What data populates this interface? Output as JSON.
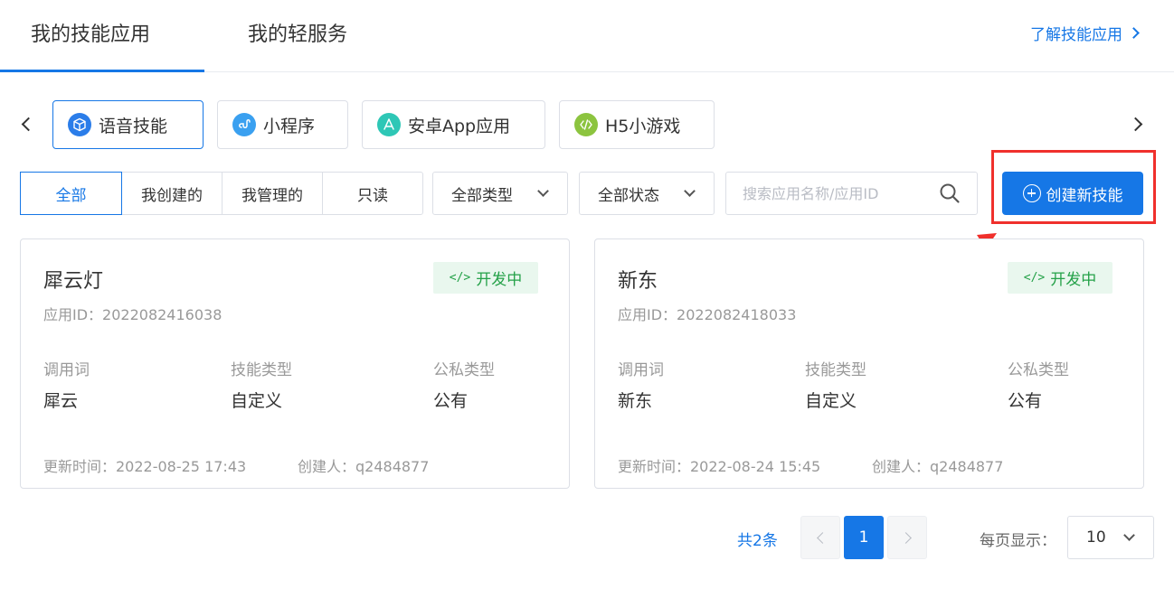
{
  "top_tabs": [
    {
      "label": "我的技能应用",
      "active": true
    },
    {
      "label": "我的轻服务",
      "active": false
    }
  ],
  "learn_link": "了解技能应用",
  "categories": [
    {
      "label": "语音技能",
      "icon": "cube-icon",
      "color": "#2b7de9",
      "active": true
    },
    {
      "label": "小程序",
      "icon": "link-icon",
      "color": "#3aa0f0",
      "active": false
    },
    {
      "label": "安卓App应用",
      "icon": "app-store-icon",
      "color": "#2ec7b6",
      "active": false
    },
    {
      "label": "H5小游戏",
      "icon": "code-icon",
      "color": "#8cc43f",
      "active": false
    }
  ],
  "filters": {
    "segments": [
      "全部",
      "我创建的",
      "我管理的",
      "只读"
    ],
    "active_segment": "全部",
    "type_select": "全部类型",
    "status_select": "全部状态",
    "search_placeholder": "搜索应用名称/应用ID"
  },
  "create_button": "创建新技能",
  "cards": [
    {
      "name": "犀云灯",
      "status": "开发中",
      "app_id": "应用ID：2022082416038",
      "cols": [
        {
          "label": "调用词",
          "value": "犀云"
        },
        {
          "label": "技能类型",
          "value": "自定义"
        },
        {
          "label": "公私类型",
          "value": "公有"
        }
      ],
      "updated": "更新时间：2022-08-25 17:43",
      "creator": "创建人：q2484877"
    },
    {
      "name": "新东",
      "status": "开发中",
      "app_id": "应用ID：2022082418033",
      "cols": [
        {
          "label": "调用词",
          "value": "新东"
        },
        {
          "label": "技能类型",
          "value": "自定义"
        },
        {
          "label": "公私类型",
          "value": "公有"
        }
      ],
      "updated": "更新时间：2022-08-24 15:45",
      "creator": "创建人：q2484877"
    }
  ],
  "pagination": {
    "total": "共2条",
    "current": "1",
    "per_page_label": "每页显示：",
    "per_page": "10"
  },
  "colors": {
    "accent": "#1677e6",
    "status_green": "#24a148",
    "highlight_red": "#f0302c"
  }
}
